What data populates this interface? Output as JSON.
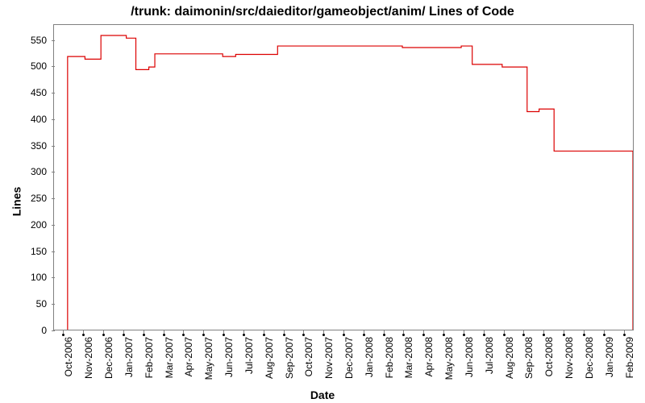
{
  "chart_data": {
    "type": "line",
    "title": "/trunk: daimonin/src/daieditor/gameobject/anim/ Lines of Code",
    "xlabel": "Date",
    "ylabel": "Lines",
    "ylim": [
      0,
      580
    ],
    "yticks": [
      0,
      50,
      100,
      150,
      200,
      250,
      300,
      350,
      400,
      450,
      500,
      550
    ],
    "categories": [
      "Oct-2006",
      "Nov-2006",
      "Dec-2006",
      "Jan-2007",
      "Feb-2007",
      "Mar-2007",
      "Apr-2007",
      "May-2007",
      "Jun-2007",
      "Jul-2007",
      "Aug-2007",
      "Sep-2007",
      "Oct-2007",
      "Nov-2007",
      "Dec-2007",
      "Jan-2008",
      "Feb-2008",
      "Mar-2008",
      "Apr-2008",
      "May-2008",
      "Jun-2008",
      "Jul-2008",
      "Aug-2008",
      "Sep-2008",
      "Oct-2008",
      "Nov-2008",
      "Dec-2008",
      "Jan-2009",
      "Feb-2009"
    ],
    "points": [
      {
        "x": 0.18,
        "y": 0
      },
      {
        "x": 0.18,
        "y": 520
      },
      {
        "x": 1.05,
        "y": 520
      },
      {
        "x": 1.05,
        "y": 515
      },
      {
        "x": 1.85,
        "y": 515
      },
      {
        "x": 1.85,
        "y": 560
      },
      {
        "x": 3.12,
        "y": 560
      },
      {
        "x": 3.12,
        "y": 555
      },
      {
        "x": 3.6,
        "y": 555
      },
      {
        "x": 3.6,
        "y": 495
      },
      {
        "x": 4.25,
        "y": 495
      },
      {
        "x": 4.25,
        "y": 500
      },
      {
        "x": 4.55,
        "y": 500
      },
      {
        "x": 4.55,
        "y": 525
      },
      {
        "x": 7.95,
        "y": 525
      },
      {
        "x": 7.95,
        "y": 520
      },
      {
        "x": 8.6,
        "y": 520
      },
      {
        "x": 8.6,
        "y": 524
      },
      {
        "x": 10.7,
        "y": 524
      },
      {
        "x": 10.7,
        "y": 540
      },
      {
        "x": 16.95,
        "y": 540
      },
      {
        "x": 16.95,
        "y": 537
      },
      {
        "x": 19.9,
        "y": 537
      },
      {
        "x": 19.9,
        "y": 540
      },
      {
        "x": 20.45,
        "y": 540
      },
      {
        "x": 20.45,
        "y": 505
      },
      {
        "x": 21.95,
        "y": 505
      },
      {
        "x": 21.95,
        "y": 500
      },
      {
        "x": 23.2,
        "y": 500
      },
      {
        "x": 23.2,
        "y": 415
      },
      {
        "x": 23.8,
        "y": 415
      },
      {
        "x": 23.8,
        "y": 420
      },
      {
        "x": 24.55,
        "y": 420
      },
      {
        "x": 24.55,
        "y": 340
      },
      {
        "x": 28.5,
        "y": 340
      },
      {
        "x": 28.5,
        "y": 0
      }
    ],
    "data_estimate": [
      {
        "date": "Oct-2006",
        "lines": 520
      },
      {
        "date": "Nov-2006",
        "lines": 515
      },
      {
        "date": "Dec-2006",
        "lines": 560
      },
      {
        "date": "Jan-2007",
        "lines": 555
      },
      {
        "date": "Feb-2007",
        "lines": 500
      },
      {
        "date": "Mar-2007",
        "lines": 525
      },
      {
        "date": "Apr-2007",
        "lines": 525
      },
      {
        "date": "May-2007",
        "lines": 525
      },
      {
        "date": "Jun-2007",
        "lines": 520
      },
      {
        "date": "Jul-2007",
        "lines": 524
      },
      {
        "date": "Aug-2007",
        "lines": 524
      },
      {
        "date": "Sep-2007",
        "lines": 540
      },
      {
        "date": "Oct-2007",
        "lines": 540
      },
      {
        "date": "Nov-2007",
        "lines": 540
      },
      {
        "date": "Dec-2007",
        "lines": 540
      },
      {
        "date": "Jan-2008",
        "lines": 540
      },
      {
        "date": "Feb-2008",
        "lines": 537
      },
      {
        "date": "Mar-2008",
        "lines": 537
      },
      {
        "date": "Apr-2008",
        "lines": 537
      },
      {
        "date": "May-2008",
        "lines": 540
      },
      {
        "date": "Jun-2008",
        "lines": 505
      },
      {
        "date": "Jul-2008",
        "lines": 505
      },
      {
        "date": "Aug-2008",
        "lines": 500
      },
      {
        "date": "Sep-2008",
        "lines": 415
      },
      {
        "date": "Oct-2008",
        "lines": 420
      },
      {
        "date": "Nov-2008",
        "lines": 340
      },
      {
        "date": "Dec-2008",
        "lines": 340
      },
      {
        "date": "Jan-2009",
        "lines": 340
      },
      {
        "date": "Feb-2009",
        "lines": 340
      }
    ],
    "series_color": "#dc0000"
  }
}
